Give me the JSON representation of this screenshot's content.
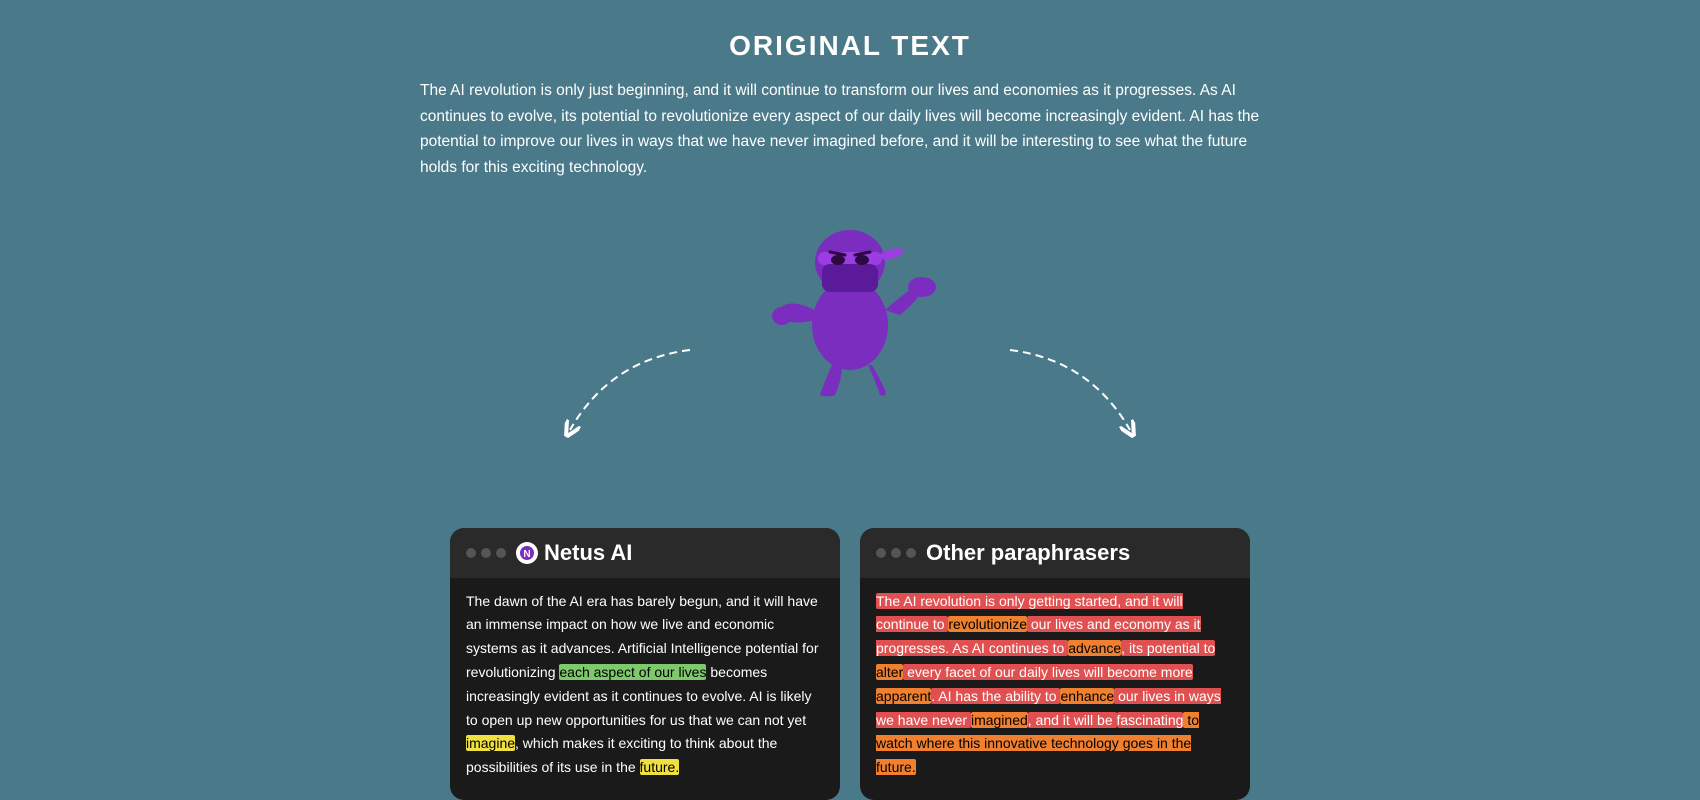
{
  "page": {
    "background_color": "#4a7a8a",
    "title": "ORIGINAL TEXT",
    "original_text": "The AI revolution is only just beginning, and it will continue to transform our lives and economies as it progresses. As AI continues to evolve, its potential to revolutionize every aspect of our daily lives will become increasingly evident. AI has the potential to improve our lives in ways that we have never imagined before, and it will be interesting to see what the future holds for this exciting technology."
  },
  "panels": {
    "netus": {
      "title": "Netus AI",
      "logo_symbol": "N",
      "content_segments": [
        {
          "text": "The dawn of the AI era has barely begun, and it will have an immense impact on how we live and economic systems as it advances. Artificial Intelligence potential for revolutionizing ",
          "highlight": "none"
        },
        {
          "text": "each aspect of our lives",
          "highlight": "green"
        },
        {
          "text": " becomes increasingly evident as it continues to evolve. AI is likely to open up new opportunities for us that we can not yet ",
          "highlight": "none"
        },
        {
          "text": "imagine",
          "highlight": "yellow"
        },
        {
          "text": ", which makes it exciting to think about the possibilities of its use in the ",
          "highlight": "none"
        },
        {
          "text": "future.",
          "highlight": "yellow"
        }
      ]
    },
    "others": {
      "title": "Other paraphrasers",
      "content_segments": [
        {
          "text": "The AI revolution is only getting started,",
          "highlight": "red"
        },
        {
          "text": " and it will continue to ",
          "highlight": "red"
        },
        {
          "text": "revolutionize",
          "highlight": "orange"
        },
        {
          "text": " our lives and economy as it progresses. As AI continues to ",
          "highlight": "red"
        },
        {
          "text": "advance",
          "highlight": "orange"
        },
        {
          "text": ", its potential to ",
          "highlight": "red"
        },
        {
          "text": "alter",
          "highlight": "orange"
        },
        {
          "text": " every facet of our daily lives will become more ",
          "highlight": "red"
        },
        {
          "text": "apparent",
          "highlight": "orange"
        },
        {
          "text": ". AI has the ability to ",
          "highlight": "red"
        },
        {
          "text": "enhance",
          "highlight": "orange"
        },
        {
          "text": " our lives in ways we have never ",
          "highlight": "red"
        },
        {
          "text": "imagined",
          "highlight": "orange"
        },
        {
          "text": ", and it will be ",
          "highlight": "red"
        },
        {
          "text": "fascinating",
          "highlight": "red"
        },
        {
          "text": " to watch where this innovative technology goes in the future.",
          "highlight": "orange"
        }
      ]
    }
  }
}
